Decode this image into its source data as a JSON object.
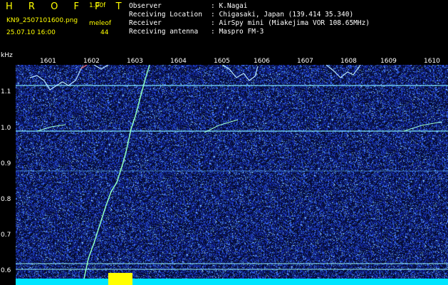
{
  "header": {
    "app_title": "HROFFT",
    "gain": "1.00f",
    "filename": "KN9_2507101600.png",
    "mode": "meleof",
    "datetime": "25.07.10 16:00",
    "count": "44"
  },
  "station_info": [
    {
      "label": "Observer",
      "value": ": K.Nagai"
    },
    {
      "label": "Receiving Location",
      "value": ": Chigasaki, Japan (139.414 35.340)"
    },
    {
      "label": "Receiver",
      "value": ": AirSpy mini (Miakejima VOR 108.65MHz)"
    },
    {
      "label": "Receiving antenna",
      "value": ": Maspro FM-3"
    }
  ],
  "axes": {
    "y_unit": "kHz",
    "y_ticks": [
      "1.1",
      "1.0",
      "0.9",
      "0.8",
      "0.7",
      "0.6"
    ],
    "x_ticks": [
      "1601",
      "1602",
      "1603",
      "1604",
      "1605",
      "1606",
      "1607",
      "1608",
      "1609",
      "1610"
    ]
  },
  "colors": {
    "background": "#000000",
    "header_yellow": "#ffff00",
    "header_white": "#ffffff",
    "noise_blue": "#1e3cc8",
    "signal_cyan": "#7fffd4",
    "baseline_cyan": "#00e5ff",
    "baseline_yellow": "#ffff00"
  }
}
